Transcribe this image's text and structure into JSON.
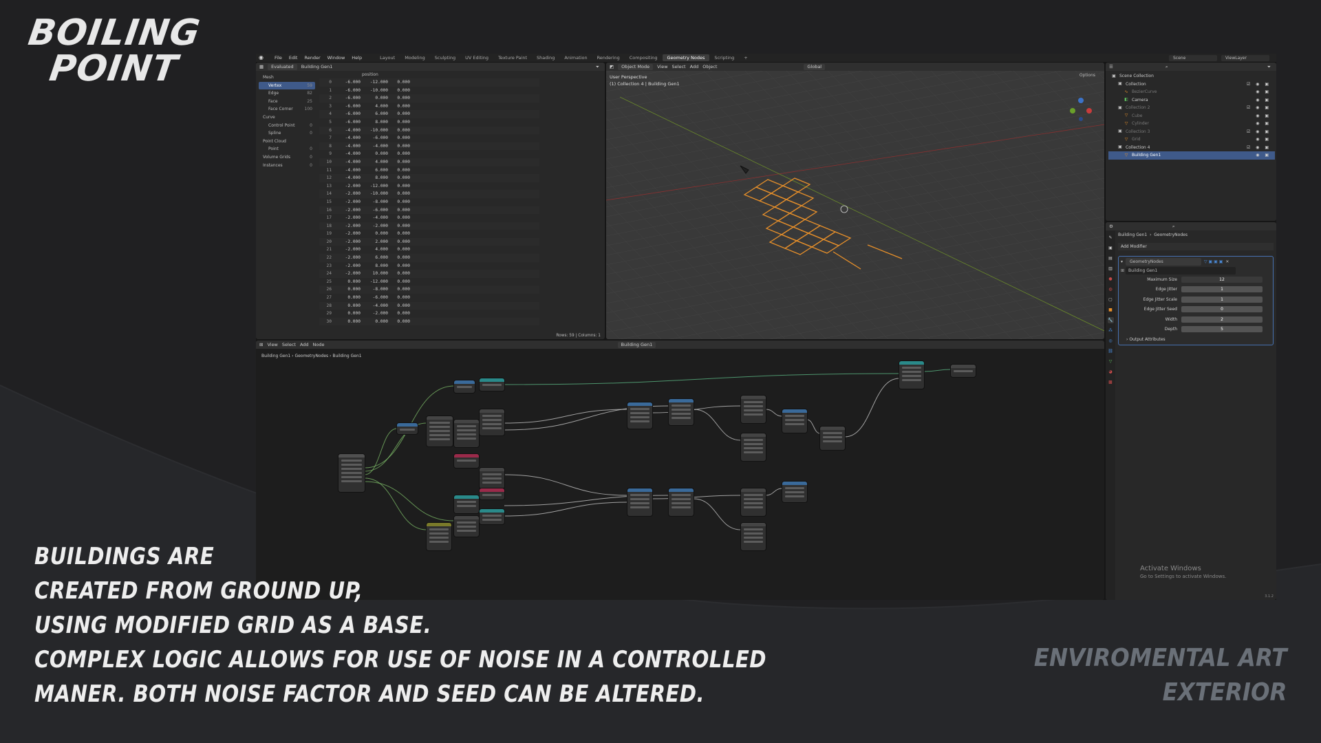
{
  "branding": {
    "title_line1": "BOILING",
    "title_line2": "POINT"
  },
  "caption": [
    "BUILDINGS ARE",
    "CREATED FROM GROUND UP,",
    "USING MODIFIED GRID AS A BASE.",
    "COMPLEX LOGIC ALLOWS FOR USE OF NOISE IN A CONTROLLED",
    "MANER. BOTH NOISE FACTOR AND SEED CAN BE ALTERED."
  ],
  "subject": {
    "line1": "ENVIROMENTAL ART",
    "line2": "EXTERIOR"
  },
  "topbar": {
    "menus": [
      "File",
      "Edit",
      "Render",
      "Window",
      "Help"
    ],
    "workspaces": [
      "Layout",
      "Modeling",
      "Sculpting",
      "UV Editing",
      "Texture Paint",
      "Shading",
      "Animation",
      "Rendering",
      "Compositing",
      "Geometry Nodes",
      "Scripting",
      "+"
    ],
    "active_workspace": "Geometry Nodes",
    "scene": "Scene",
    "view_layer": "ViewLayer"
  },
  "spreadsheet": {
    "mode": "Evaluated",
    "object": "Building Gen1",
    "column": "position",
    "sidebar": [
      {
        "label": "Mesh",
        "count": "",
        "level": 0
      },
      {
        "label": "Vertex",
        "count": "59",
        "level": 1,
        "selected": true
      },
      {
        "label": "Edge",
        "count": "82",
        "level": 1
      },
      {
        "label": "Face",
        "count": "25",
        "level": 1
      },
      {
        "label": "Face Corner",
        "count": "100",
        "level": 1
      },
      {
        "label": "Curve",
        "count": "",
        "level": 0
      },
      {
        "label": "Control Point",
        "count": "0",
        "level": 1
      },
      {
        "label": "Spline",
        "count": "0",
        "level": 1
      },
      {
        "label": "Point Cloud",
        "count": "",
        "level": 0
      },
      {
        "label": "Point",
        "count": "0",
        "level": 1
      },
      {
        "label": "Volume Grids",
        "count": "0",
        "level": 0
      },
      {
        "label": "Instances",
        "count": "0",
        "level": 0
      }
    ],
    "rows": [
      [
        "0",
        "-6.000",
        "-12.000",
        "0.000"
      ],
      [
        "1",
        "-6.000",
        "-10.000",
        "0.000"
      ],
      [
        "2",
        "-6.000",
        "0.000",
        "0.000"
      ],
      [
        "3",
        "-6.000",
        "4.000",
        "0.000"
      ],
      [
        "4",
        "-6.000",
        "6.000",
        "0.000"
      ],
      [
        "5",
        "-6.000",
        "8.000",
        "0.000"
      ],
      [
        "6",
        "-4.000",
        "-10.000",
        "0.000"
      ],
      [
        "7",
        "-4.000",
        "-6.000",
        "0.000"
      ],
      [
        "8",
        "-4.000",
        "-4.000",
        "0.000"
      ],
      [
        "9",
        "-4.000",
        "0.000",
        "0.000"
      ],
      [
        "10",
        "-4.000",
        "4.000",
        "0.000"
      ],
      [
        "11",
        "-4.000",
        "6.000",
        "0.000"
      ],
      [
        "12",
        "-4.000",
        "8.000",
        "0.000"
      ],
      [
        "13",
        "-2.000",
        "-12.000",
        "0.000"
      ],
      [
        "14",
        "-2.000",
        "-10.000",
        "0.000"
      ],
      [
        "15",
        "-2.000",
        "-8.000",
        "0.000"
      ],
      [
        "16",
        "-2.000",
        "-6.000",
        "0.000"
      ],
      [
        "17",
        "-2.000",
        "-4.000",
        "0.000"
      ],
      [
        "18",
        "-2.000",
        "-2.000",
        "0.000"
      ],
      [
        "19",
        "-2.000",
        "0.000",
        "0.000"
      ],
      [
        "20",
        "-2.000",
        "2.000",
        "0.000"
      ],
      [
        "21",
        "-2.000",
        "4.000",
        "0.000"
      ],
      [
        "22",
        "-2.000",
        "6.000",
        "0.000"
      ],
      [
        "23",
        "-2.000",
        "8.000",
        "0.000"
      ],
      [
        "24",
        "-2.000",
        "10.000",
        "0.000"
      ],
      [
        "25",
        "0.000",
        "-12.000",
        "0.000"
      ],
      [
        "26",
        "0.000",
        "-8.000",
        "0.000"
      ],
      [
        "27",
        "0.000",
        "-6.000",
        "0.000"
      ],
      [
        "28",
        "0.000",
        "-4.000",
        "0.000"
      ],
      [
        "29",
        "0.000",
        "-2.000",
        "0.000"
      ],
      [
        "30",
        "0.000",
        "0.000",
        "0.000"
      ]
    ],
    "footer": "Rows: 59  |  Columns: 1"
  },
  "viewport": {
    "mode": "Object Mode",
    "menus": [
      "View",
      "Select",
      "Add",
      "Object"
    ],
    "orientation": "Global",
    "label1": "User Perspective",
    "label2": "(1) Collection 4 | Building Gen1",
    "options": "Options"
  },
  "outliner": {
    "search_placeholder": "",
    "items": [
      {
        "label": "Scene Collection",
        "depth": 0,
        "icon": "collection-icon"
      },
      {
        "label": "Collection",
        "depth": 1,
        "icon": "collection-icon",
        "check": true
      },
      {
        "label": "BezierCurve",
        "depth": 2,
        "icon": "curve-icon",
        "dim": true
      },
      {
        "label": "Camera",
        "depth": 2,
        "icon": "camera-icon"
      },
      {
        "label": "Collection 2",
        "depth": 1,
        "icon": "collection-icon",
        "check": true,
        "dim": true
      },
      {
        "label": "Cube",
        "depth": 2,
        "icon": "mesh-icon",
        "dim": true
      },
      {
        "label": "Cylinder",
        "depth": 2,
        "icon": "mesh-icon",
        "dim": true
      },
      {
        "label": "Collection 3",
        "depth": 1,
        "icon": "collection-icon",
        "check": true,
        "dim": true
      },
      {
        "label": "Grid",
        "depth": 2,
        "icon": "mesh-icon",
        "dim": true
      },
      {
        "label": "Collection 4",
        "depth": 1,
        "icon": "collection-icon",
        "check": true
      },
      {
        "label": "Building Gen1",
        "depth": 2,
        "icon": "mesh-icon",
        "selected": true
      }
    ]
  },
  "properties": {
    "breadcrumb_obj": "Building Gen1",
    "breadcrumb_mod": "GeometryNodes",
    "add_modifier": "Add Modifier",
    "modifier_name": "GeometryNodes",
    "node_group": "Building Gen1",
    "inputs": [
      {
        "label": "Maximum Size",
        "value": "12",
        "slider": false
      },
      {
        "label": "Edge Jitter",
        "value": "1",
        "slider": true
      },
      {
        "label": "Edge Jitter Scale",
        "value": "1",
        "slider": true
      },
      {
        "label": "Edge Jitter Seed",
        "value": "0",
        "slider": true
      },
      {
        "label": "Width",
        "value": "2",
        "slider": true
      },
      {
        "label": "Depth",
        "value": "5",
        "slider": true
      }
    ],
    "output_attributes": "Output Attributes",
    "activate_title": "Activate Windows",
    "activate_sub": "Go to Settings to activate Windows.",
    "version": "3.1.2"
  },
  "node_editor": {
    "menus": [
      "View",
      "Select",
      "Add",
      "Node"
    ],
    "node_group": "Building Gen1",
    "breadcrumb": [
      "Building Gen1",
      "GeometryNodes",
      "Building Gen1"
    ]
  },
  "colors": {
    "accent": "#4772b3",
    "grid_orange": "#e8902a",
    "node_teal": "#2a8a8a",
    "link_green": "#5fbf8a"
  }
}
